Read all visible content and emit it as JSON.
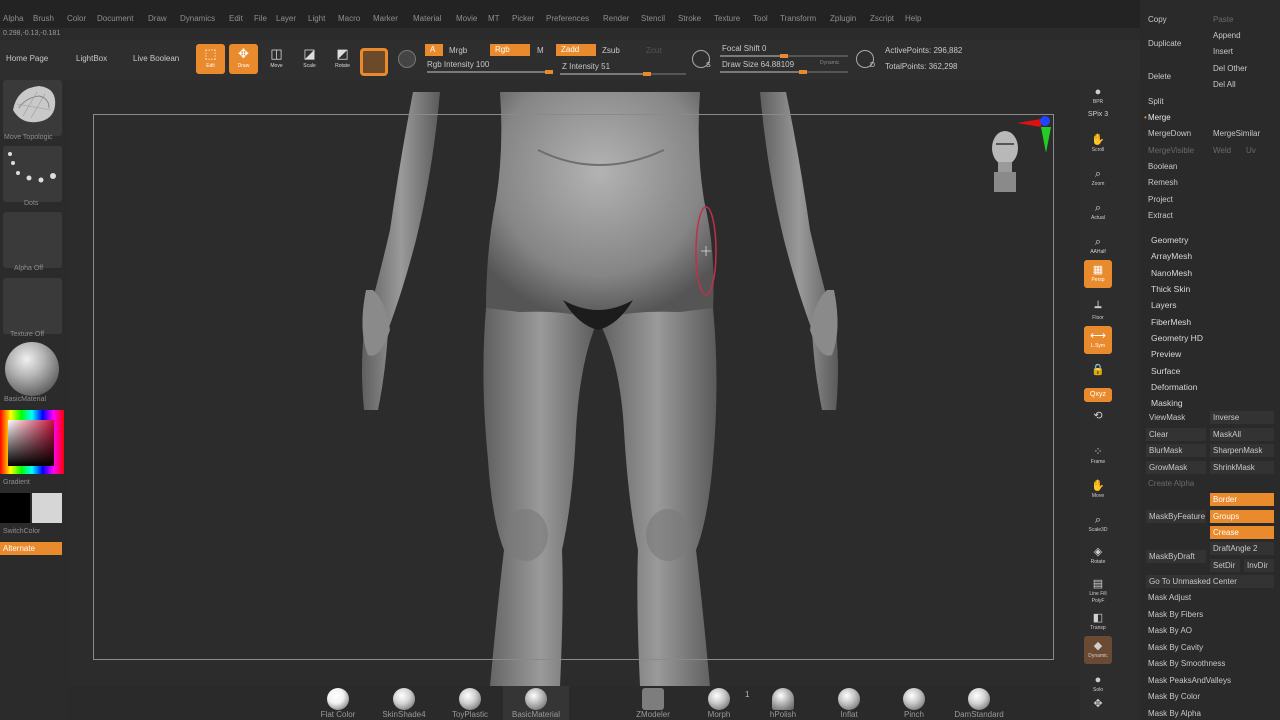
{
  "menu": [
    "Alpha",
    "Brush",
    "Color",
    "Document",
    "Draw",
    "Dynamics",
    "Edit",
    "File",
    "Layer",
    "Light",
    "Macro",
    "Marker",
    "Material",
    "Movie",
    "MT",
    "Picker",
    "Preferences",
    "Render",
    "Stencil",
    "Stroke",
    "Texture",
    "Tool",
    "Transform",
    "Zplugin",
    "Zscript",
    "Help"
  ],
  "coords": "0.298,-0.13,-0.181",
  "toolbar": {
    "home_page": "Home Page",
    "lightbox": "LightBox",
    "live_boolean": "Live Boolean",
    "tools": [
      {
        "label": "Edit",
        "icon": "edit-icon",
        "glyph": "⬚",
        "on": true
      },
      {
        "label": "Draw",
        "icon": "draw-icon",
        "glyph": "✥",
        "on": true
      },
      {
        "label": "Move",
        "icon": "move-icon",
        "glyph": "◫",
        "on": false
      },
      {
        "label": "Scale",
        "icon": "scale-icon",
        "glyph": "◪",
        "on": false
      },
      {
        "label": "Rotate",
        "icon": "rotate-icon",
        "glyph": "◩",
        "on": false
      }
    ],
    "a_label": "A",
    "mrgb": "Mrgb",
    "rgb": "Rgb",
    "m": "M",
    "zadd": "Zadd",
    "zsub": "Zsub",
    "zcut": "Zcut",
    "rgb_intensity": "Rgb Intensity 100",
    "z_intensity": "Z Intensity 51",
    "focal_shift": "Focal Shift 0",
    "draw_size": "Draw Size 64.88109",
    "dynamic": "Dynamic",
    "active_points": "ActivePoints: 296,882",
    "total_points": "TotalPoints: 362,298",
    "s_label": "S",
    "d_label": "D"
  },
  "left": {
    "brush_caption": "Move Topologic",
    "stroke_caption": "Dots",
    "alpha_caption": "Alpha Off",
    "texture_caption": "Texture Off",
    "material_caption": "BasicMaterial",
    "gradient": "Gradient",
    "switch_color": "SwitchColor",
    "alternate": "Alternate"
  },
  "shelf": [
    {
      "label": "Flat Color",
      "icon": "flat-color-icon"
    },
    {
      "label": "SkinShade4",
      "icon": "skinshade4-icon"
    },
    {
      "label": "ToyPlastic",
      "icon": "toyplastic-icon"
    },
    {
      "label": "BasicMaterial",
      "icon": "basicmaterial-icon"
    },
    {
      "label": "ZModeler",
      "icon": "zmodeler-icon"
    },
    {
      "label": "Morph",
      "icon": "morph-icon"
    },
    {
      "label": "hPolish",
      "icon": "hpolish-icon"
    },
    {
      "label": "Inflat",
      "icon": "inflat-icon"
    },
    {
      "label": "Pinch",
      "icon": "pinch-icon"
    },
    {
      "label": "DamStandard",
      "icon": "damstandard-icon"
    }
  ],
  "zmodeler_count": "1",
  "rshelf": [
    {
      "label": "BPR",
      "icon": "bpr-icon",
      "glyph": "●",
      "on": false
    },
    {
      "label": "SPix 3",
      "icon": "spix-icon",
      "glyph": "",
      "on": false
    },
    {
      "label": "Scroll",
      "icon": "scroll-icon",
      "glyph": "✋",
      "on": false
    },
    {
      "label": "Zoom",
      "icon": "zoom-icon",
      "glyph": "⌕",
      "on": false
    },
    {
      "label": "Actual",
      "icon": "actual-icon",
      "glyph": "⌕",
      "on": false
    },
    {
      "label": "AAHalf",
      "icon": "aahalf-icon",
      "glyph": "⌕",
      "on": false
    },
    {
      "label": "Persp",
      "icon": "persp-icon",
      "glyph": "▦",
      "on": true
    },
    {
      "label": "Floor",
      "icon": "floor-icon",
      "glyph": "┷",
      "on": false
    },
    {
      "label": "L.Sym",
      "icon": "local-symmetry-icon",
      "glyph": "⟷",
      "on": true
    },
    {
      "label": "",
      "icon": "lock-icon",
      "glyph": "🔒",
      "on": false
    },
    {
      "label": "Qxyz",
      "icon": "xyz-icon",
      "glyph": "",
      "on": true
    },
    {
      "label": "",
      "icon": "rotate-y-icon",
      "glyph": "⟲",
      "on": false
    },
    {
      "label": "Frame",
      "icon": "frame-icon",
      "glyph": "⁘",
      "on": false
    },
    {
      "label": "Move",
      "icon": "move-view-icon",
      "glyph": "✋",
      "on": false
    },
    {
      "label": "Scale3D",
      "icon": "scale3d-icon",
      "glyph": "⌕",
      "on": false
    },
    {
      "label": "Rotate",
      "icon": "rotate-view-icon",
      "glyph": "◈",
      "on": false
    },
    {
      "label": "Line Fill PolyF",
      "icon": "polyframe-icon",
      "glyph": "▤",
      "on": false
    },
    {
      "label": "Transp",
      "icon": "transp-icon",
      "glyph": "◧",
      "on": false
    },
    {
      "label": "Dynamic",
      "icon": "dynamic-icon",
      "glyph": "◆",
      "on": false
    },
    {
      "label": "Solo",
      "icon": "solo-icon",
      "glyph": "●",
      "on": false
    },
    {
      "label": "",
      "icon": "xpose-icon",
      "glyph": "✥",
      "on": false
    }
  ],
  "subtool": {
    "copy": "Copy",
    "paste": "Paste",
    "append": "Append",
    "duplicate": "Duplicate",
    "insert": "Insert",
    "delete": "Delete",
    "del_other": "Del Other",
    "del_all": "Del All",
    "split": "Split",
    "merge": "Merge",
    "merge_down": "MergeDown",
    "merge_similar": "MergeSimilar",
    "merge_visible": "MergeVisible",
    "weld": "Weld",
    "uv": "Uv",
    "boolean": "Boolean",
    "remesh": "Remesh",
    "project": "Project",
    "extract": "Extract"
  },
  "sections": [
    "Geometry",
    "ArrayMesh",
    "NanoMesh",
    "Thick Skin",
    "Layers",
    "FiberMesh",
    "Geometry HD",
    "Preview",
    "Surface",
    "Deformation",
    "Masking"
  ],
  "masking": {
    "view_mask": "ViewMask",
    "inverse": "Inverse",
    "clear": "Clear",
    "mask_all": "MaskAll",
    "blur_mask": "BlurMask",
    "sharpen_mask": "SharpenMask",
    "grow_mask": "GrowMask",
    "shrink_mask": "ShrinkMask",
    "create_alpha": "Create Alpha",
    "mask_by_feature": "MaskByFeature",
    "border": "Border",
    "groups": "Groups",
    "crease": "Crease",
    "mask_by_draft": "MaskByDraft",
    "draft_angle": "DraftAngle 2",
    "set_dir": "SetDir",
    "inv_dir": "InvDir",
    "goto_unmasked": "Go To Unmasked Center",
    "mask_items": [
      "Mask Adjust",
      "Mask By Fibers",
      "Mask By AO",
      "Mask By Cavity",
      "Mask By Smoothness",
      "Mask PeaksAndValleys",
      "Mask By Color",
      "Mask By Alpha"
    ]
  },
  "colors": {
    "accent": "#e98a2d",
    "panel": "#2a2a2a",
    "canvas": "#2c2c2c",
    "brush_ring": "#c0304a"
  },
  "progress": {
    "rgb_intensity": 1.0,
    "z_intensity": 0.51,
    "focal_shift": 0.5,
    "draw_size": 0.65
  }
}
